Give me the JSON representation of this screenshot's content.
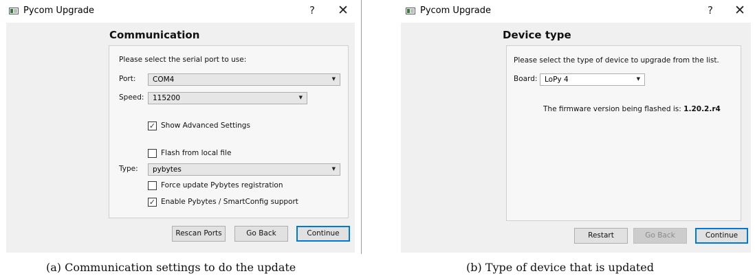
{
  "window_a": {
    "title": "Pycom Upgrade",
    "help_glyph": "?",
    "close_glyph": "✕",
    "heading": "Communication",
    "instruction": "Please select the serial port to use:",
    "port": {
      "label": "Port:",
      "value": "COM4"
    },
    "speed": {
      "label": "Speed:",
      "value": "115200"
    },
    "show_advanced": {
      "label": "Show Advanced Settings",
      "checked": true
    },
    "flash_local": {
      "label": "Flash from local file",
      "checked": false
    },
    "type": {
      "label": "Type:",
      "value": "pybytes"
    },
    "force_update": {
      "label": "Force update Pybytes registration",
      "checked": false
    },
    "enable_pybytes": {
      "label": "Enable Pybytes / SmartConfig support",
      "checked": true
    },
    "buttons": {
      "rescan": "Rescan Ports",
      "go_back": "Go Back",
      "continue": "Continue"
    },
    "check_glyph": "✓",
    "arrow_glyph": "▼"
  },
  "window_b": {
    "title": "Pycom Upgrade",
    "help_glyph": "?",
    "close_glyph": "✕",
    "heading": "Device type",
    "instruction": "Please select the type of device to upgrade from the list.",
    "board": {
      "label": "Board:",
      "value": "LoPy 4"
    },
    "firmware_prefix": "The firmware version being flashed is:",
    "firmware_version": "1.20.2.r4",
    "buttons": {
      "restart": "Restart",
      "go_back": "Go Back",
      "continue": "Continue"
    },
    "go_back_disabled": true,
    "arrow_glyph": "▼"
  },
  "captions": {
    "a": "(a) Communication settings to do the update",
    "b": "(b) Type of device that is updated"
  }
}
